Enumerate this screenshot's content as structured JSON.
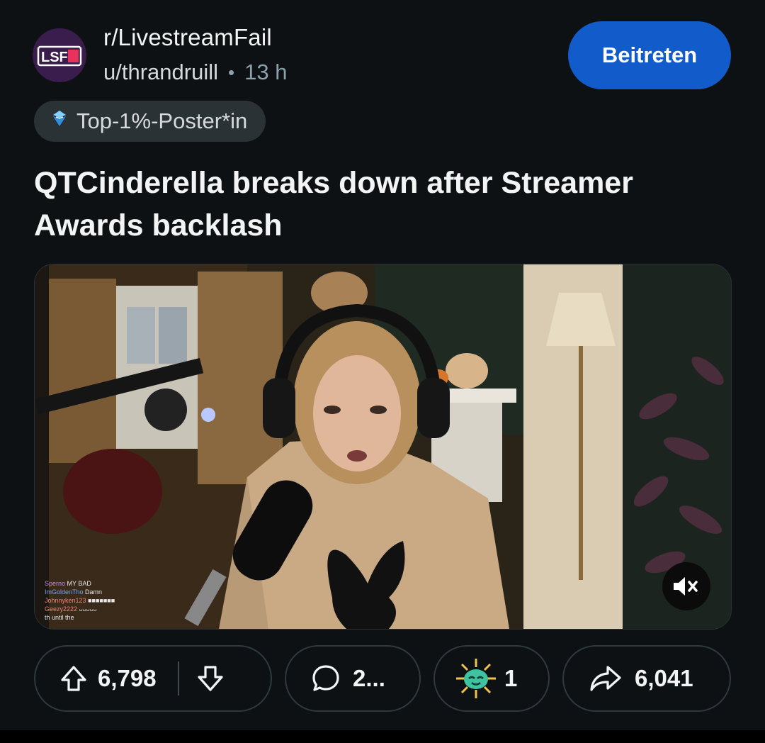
{
  "post": {
    "subreddit": "r/LivestreamFail",
    "subreddit_logo_text": "LSF",
    "author": "u/thrandruill",
    "separator": "•",
    "age": "13 h",
    "join_label": "Beitreten",
    "flair": "Top-1%-Poster*in",
    "title": "QTCinderella breaks down after Streamer Awards backlash"
  },
  "video": {
    "muted": true,
    "chat": [
      {
        "user": "Sperno",
        "message": "MY BAD"
      },
      {
        "user": "ImGoldenTho",
        "message": "Damn"
      },
      {
        "user": "Johnnyken123",
        "message": "■■■■■■■"
      },
      {
        "user": "Geezy2222",
        "message": "ᴗᴗᴗᴗᴗ"
      },
      {
        "user": "",
        "message": "th until the"
      }
    ]
  },
  "actions": {
    "upvotes": "6,798",
    "comments": "2...",
    "awards": "1",
    "shares": "6,041"
  },
  "colors": {
    "background": "#0e1113",
    "join_button": "#115bca",
    "pill_border": "#2f3a3f",
    "flair_bg": "#2a3236"
  },
  "icons": [
    "upvote-icon",
    "downvote-icon",
    "comment-icon",
    "award-icon",
    "share-icon",
    "mute-icon",
    "top-poster-icon"
  ]
}
